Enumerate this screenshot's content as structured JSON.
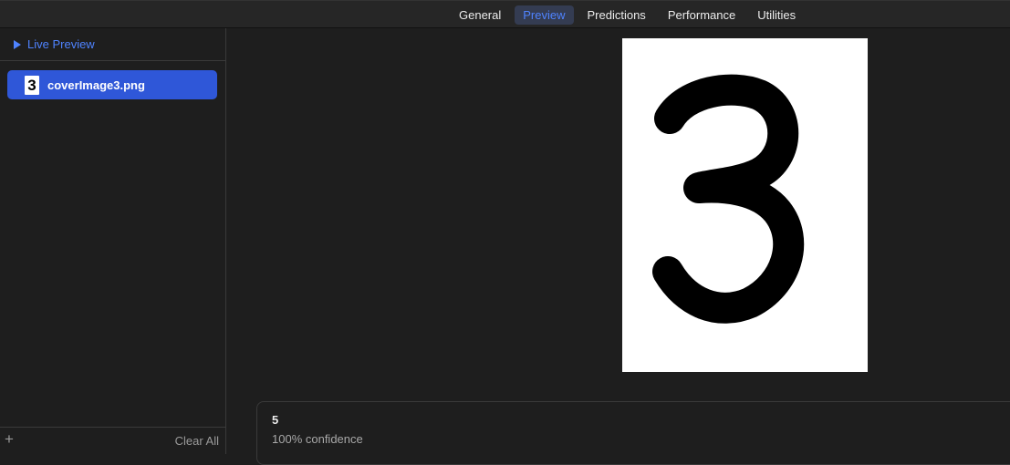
{
  "tabs": [
    {
      "label": "General",
      "active": false
    },
    {
      "label": "Preview",
      "active": true
    },
    {
      "label": "Predictions",
      "active": false
    },
    {
      "label": "Performance",
      "active": false
    },
    {
      "label": "Utilities",
      "active": false
    }
  ],
  "sidebar": {
    "live_preview_label": "Live Preview",
    "files": [
      {
        "name": "coverImage3.png",
        "thumbnail_glyph": "3",
        "selected": true
      }
    ],
    "add_icon": "plus-icon",
    "clear_all_label": "Clear All"
  },
  "preview": {
    "image_glyph": "3"
  },
  "result": {
    "label": "5",
    "confidence": "100% confidence"
  },
  "colors": {
    "accent": "#4f83ff",
    "selection": "#2f57d8",
    "background": "#1e1e1e"
  }
}
